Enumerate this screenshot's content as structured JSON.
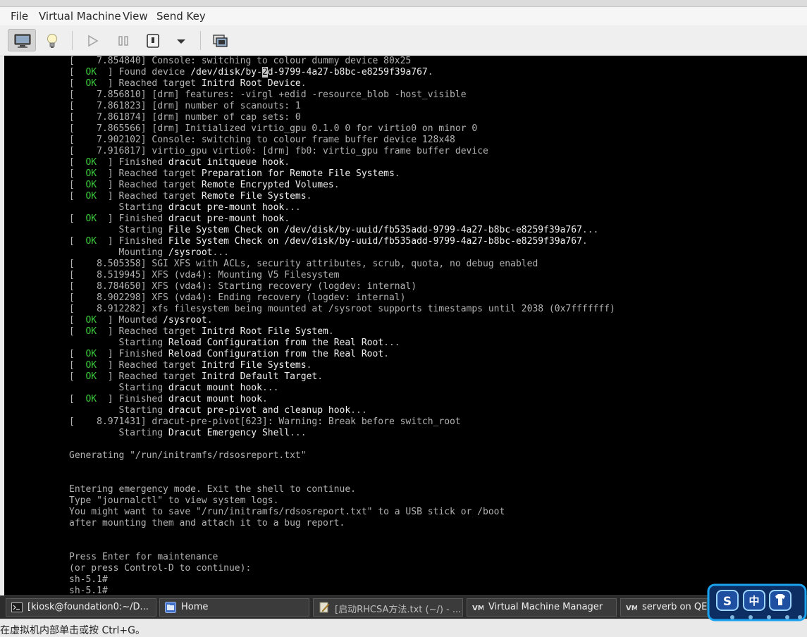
{
  "menubar": {
    "items": [
      "File",
      "Virtual Machine",
      "View",
      "Send Key"
    ]
  },
  "toolbar": {
    "buttons": [
      {
        "name": "console",
        "icon": "monitor-icon"
      },
      {
        "name": "details",
        "icon": "lightbulb-icon"
      },
      {
        "name": "run",
        "icon": "play-icon"
      },
      {
        "name": "pause",
        "icon": "pause-icon"
      },
      {
        "name": "shutdown",
        "icon": "power-icon"
      },
      {
        "name": "shutdown-menu",
        "icon": "chevron-down-icon"
      },
      {
        "name": "snapshots",
        "icon": "snapshot-icon"
      }
    ]
  },
  "console": {
    "lines": [
      [
        {
          "t": "[    7.854840] Console: switching to colour dummy device 80x25"
        }
      ],
      [
        {
          "t": "[  "
        },
        {
          "t": "OK",
          "c": "ok"
        },
        {
          "t": "  ] Found device "
        },
        {
          "t": "/dev/disk/by-",
          "c": "bright"
        },
        {
          "t": "2",
          "c": "cursor"
        },
        {
          "t": "d-9799-4a27-b8bc-e8259f39a767",
          "c": "bright"
        },
        {
          "t": "."
        }
      ],
      [
        {
          "t": "[  "
        },
        {
          "t": "OK",
          "c": "ok"
        },
        {
          "t": "  ] Reached target "
        },
        {
          "t": "Initrd Root Device",
          "c": "bright"
        },
        {
          "t": "."
        }
      ],
      [
        {
          "t": "[    7.856810] [drm] features: -virgl +edid -resource_blob -host_visible"
        }
      ],
      [
        {
          "t": "[    7.861823] [drm] number of scanouts: 1"
        }
      ],
      [
        {
          "t": "[    7.861874] [drm] number of cap sets: 0"
        }
      ],
      [
        {
          "t": "[    7.865566] [drm] Initialized virtio_gpu 0.1.0 0 for virtio0 on minor 0"
        }
      ],
      [
        {
          "t": "[    7.902102] Console: switching to colour frame buffer device 128x48"
        }
      ],
      [
        {
          "t": "[    7.916817] virtio_gpu virtio0: [drm] fb0: virtio_gpu frame buffer device"
        }
      ],
      [
        {
          "t": "[  "
        },
        {
          "t": "OK",
          "c": "ok"
        },
        {
          "t": "  ] Finished "
        },
        {
          "t": "dracut initqueue hook",
          "c": "bright"
        },
        {
          "t": "."
        }
      ],
      [
        {
          "t": "[  "
        },
        {
          "t": "OK",
          "c": "ok"
        },
        {
          "t": "  ] Reached target "
        },
        {
          "t": "Preparation for Remote File Systems",
          "c": "bright"
        },
        {
          "t": "."
        }
      ],
      [
        {
          "t": "[  "
        },
        {
          "t": "OK",
          "c": "ok"
        },
        {
          "t": "  ] Reached target "
        },
        {
          "t": "Remote Encrypted Volumes",
          "c": "bright"
        },
        {
          "t": "."
        }
      ],
      [
        {
          "t": "[  "
        },
        {
          "t": "OK",
          "c": "ok"
        },
        {
          "t": "  ] Reached target "
        },
        {
          "t": "Remote File Systems",
          "c": "bright"
        },
        {
          "t": "."
        }
      ],
      [
        {
          "t": "         Starting "
        },
        {
          "t": "dracut pre-mount hook",
          "c": "bright"
        },
        {
          "t": "..."
        }
      ],
      [
        {
          "t": "[  "
        },
        {
          "t": "OK",
          "c": "ok"
        },
        {
          "t": "  ] Finished "
        },
        {
          "t": "dracut pre-mount hook",
          "c": "bright"
        },
        {
          "t": "."
        }
      ],
      [
        {
          "t": "         Starting "
        },
        {
          "t": "File System Check on /dev/disk/by-uuid/fb535add-9799-4a27-b8bc-e8259f39a767",
          "c": "bright"
        },
        {
          "t": "..."
        }
      ],
      [
        {
          "t": "[  "
        },
        {
          "t": "OK",
          "c": "ok"
        },
        {
          "t": "  ] Finished "
        },
        {
          "t": "File System Check on /dev/disk/by-uuid/fb535add-9799-4a27-b8bc-e8259f39a767",
          "c": "bright"
        },
        {
          "t": "."
        }
      ],
      [
        {
          "t": "         Mounting "
        },
        {
          "t": "/sysroot",
          "c": "bright"
        },
        {
          "t": "..."
        }
      ],
      [
        {
          "t": "[    8.505358] SGI XFS with ACLs, security attributes, scrub, quota, no debug enabled"
        }
      ],
      [
        {
          "t": "[    8.519945] XFS (vda4): Mounting V5 Filesystem"
        }
      ],
      [
        {
          "t": "[    8.784650] XFS (vda4): Starting recovery (logdev: internal)"
        }
      ],
      [
        {
          "t": "[    8.902298] XFS (vda4): Ending recovery (logdev: internal)"
        }
      ],
      [
        {
          "t": "[    8.912282] xfs filesystem being mounted at /sysroot supports timestamps until 2038 (0x7fffffff)"
        }
      ],
      [
        {
          "t": "[  "
        },
        {
          "t": "OK",
          "c": "ok"
        },
        {
          "t": "  ] Mounted "
        },
        {
          "t": "/sysroot",
          "c": "bright"
        },
        {
          "t": "."
        }
      ],
      [
        {
          "t": "[  "
        },
        {
          "t": "OK",
          "c": "ok"
        },
        {
          "t": "  ] Reached target "
        },
        {
          "t": "Initrd Root File System",
          "c": "bright"
        },
        {
          "t": "."
        }
      ],
      [
        {
          "t": "         Starting "
        },
        {
          "t": "Reload Configuration from the Real Root",
          "c": "bright"
        },
        {
          "t": "..."
        }
      ],
      [
        {
          "t": "[  "
        },
        {
          "t": "OK",
          "c": "ok"
        },
        {
          "t": "  ] Finished "
        },
        {
          "t": "Reload Configuration from the Real Root",
          "c": "bright"
        },
        {
          "t": "."
        }
      ],
      [
        {
          "t": "[  "
        },
        {
          "t": "OK",
          "c": "ok"
        },
        {
          "t": "  ] Reached target "
        },
        {
          "t": "Initrd File Systems",
          "c": "bright"
        },
        {
          "t": "."
        }
      ],
      [
        {
          "t": "[  "
        },
        {
          "t": "OK",
          "c": "ok"
        },
        {
          "t": "  ] Reached target "
        },
        {
          "t": "Initrd Default Target",
          "c": "bright"
        },
        {
          "t": "."
        }
      ],
      [
        {
          "t": "         Starting "
        },
        {
          "t": "dracut mount hook",
          "c": "bright"
        },
        {
          "t": "..."
        }
      ],
      [
        {
          "t": "[  "
        },
        {
          "t": "OK",
          "c": "ok"
        },
        {
          "t": "  ] Finished "
        },
        {
          "t": "dracut mount hook",
          "c": "bright"
        },
        {
          "t": "."
        }
      ],
      [
        {
          "t": "         Starting "
        },
        {
          "t": "dracut pre-pivot and cleanup hook",
          "c": "bright"
        },
        {
          "t": "..."
        }
      ],
      [
        {
          "t": "[    8.971431] dracut-pre-pivot[623]: Warning: Break before switch_root"
        }
      ],
      [
        {
          "t": "         Starting "
        },
        {
          "t": "Dracut Emergency Shell",
          "c": "bright"
        },
        {
          "t": "..."
        }
      ],
      [
        {
          "t": ""
        }
      ],
      [
        {
          "t": "Generating \"/run/initramfs/rdsosreport.txt\""
        }
      ],
      [
        {
          "t": ""
        }
      ],
      [
        {
          "t": ""
        }
      ],
      [
        {
          "t": "Entering emergency mode. Exit the shell to continue."
        }
      ],
      [
        {
          "t": "Type \"journalctl\" to view system logs."
        }
      ],
      [
        {
          "t": "You might want to save \"/run/initramfs/rdsosreport.txt\" to a USB stick or /boot"
        }
      ],
      [
        {
          "t": "after mounting them and attach it to a bug report."
        }
      ],
      [
        {
          "t": ""
        }
      ],
      [
        {
          "t": ""
        }
      ],
      [
        {
          "t": "Press Enter for maintenance"
        }
      ],
      [
        {
          "t": "(or press Control-D to continue):"
        }
      ],
      [
        {
          "t": "sh-5.1#"
        }
      ],
      [
        {
          "t": "sh-5.1#"
        }
      ]
    ]
  },
  "taskbar": {
    "items": [
      {
        "label": "[kiosk@foundation0:~/D...",
        "icon": "terminal-icon"
      },
      {
        "label": "Home",
        "icon": "folder-icon"
      },
      {
        "label": "[启动RHCSA方法.txt (~/) - ...",
        "icon": "text-editor-icon"
      },
      {
        "label": "Virtual Machine Manager",
        "icon": "virt-manager-icon"
      },
      {
        "label": "serverb on QEMU",
        "icon": "virt-manager-icon"
      }
    ]
  },
  "ime": {
    "items": [
      "S",
      "中",
      "shirt"
    ]
  },
  "status": {
    "text": "在虚拟机内部单击或按 Ctrl+G。"
  }
}
